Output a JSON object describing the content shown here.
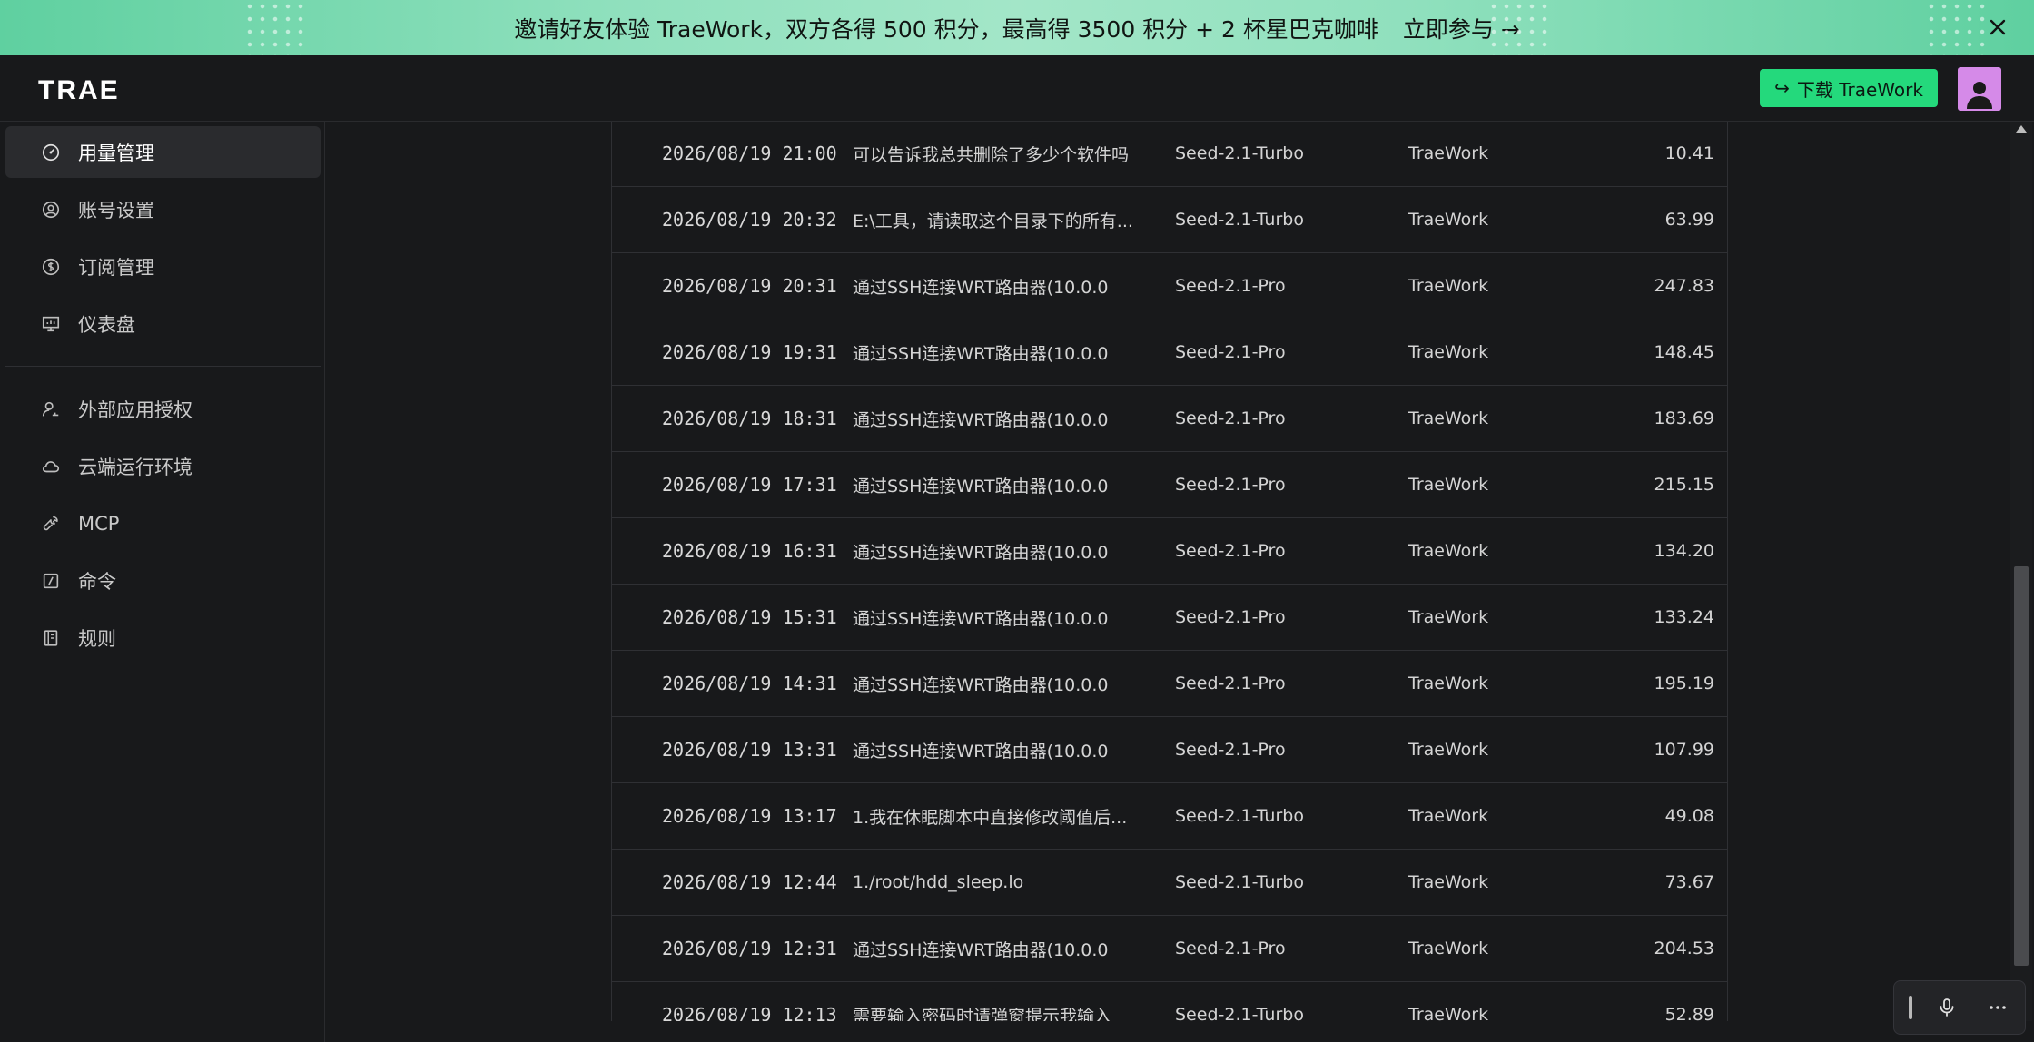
{
  "banner": {
    "text": "邀请好友体验 TraeWork，双方各得 500 积分，最高得 3500 积分 + 2 杯星巴克咖啡",
    "cta": "立即参与 →",
    "background_color": "#8fe0bd"
  },
  "header": {
    "logo": "TRAE",
    "download_label": "下载 TraeWork",
    "accent_color": "#24d97c"
  },
  "sidebar": {
    "items": [
      {
        "label": "用量管理",
        "icon": "gauge-icon",
        "active": true
      },
      {
        "label": "账号设置",
        "icon": "user-circle-icon",
        "active": false
      },
      {
        "label": "订阅管理",
        "icon": "dollar-circle-icon",
        "active": false
      },
      {
        "label": "仪表盘",
        "icon": "monitor-icon",
        "active": false
      },
      {
        "label": "外部应用授权",
        "icon": "user-key-icon",
        "active": false
      },
      {
        "label": "云端运行环境",
        "icon": "cloud-icon",
        "active": false
      },
      {
        "label": "MCP",
        "icon": "wrench-icon",
        "active": false
      },
      {
        "label": "命令",
        "icon": "slash-command-icon",
        "active": false
      },
      {
        "label": "规则",
        "icon": "rules-book-icon",
        "active": false
      }
    ]
  },
  "usage": {
    "rows": [
      {
        "time": "2026/08/19 21:00",
        "title": "可以告诉我总共删除了多少个软件吗",
        "model": "Seed-2.1-Turbo",
        "app": "TraeWork",
        "amount": "10.41"
      },
      {
        "time": "2026/08/19 20:32",
        "title": "E:\\工具，请读取这个目录下的所有...",
        "model": "Seed-2.1-Turbo",
        "app": "TraeWork",
        "amount": "63.99"
      },
      {
        "time": "2026/08/19 20:31",
        "title": "通过SSH连接WRT路由器(10.0.0",
        "model": "Seed-2.1-Pro",
        "app": "TraeWork",
        "amount": "247.83"
      },
      {
        "time": "2026/08/19 19:31",
        "title": "通过SSH连接WRT路由器(10.0.0",
        "model": "Seed-2.1-Pro",
        "app": "TraeWork",
        "amount": "148.45"
      },
      {
        "time": "2026/08/19 18:31",
        "title": "通过SSH连接WRT路由器(10.0.0",
        "model": "Seed-2.1-Pro",
        "app": "TraeWork",
        "amount": "183.69"
      },
      {
        "time": "2026/08/19 17:31",
        "title": "通过SSH连接WRT路由器(10.0.0",
        "model": "Seed-2.1-Pro",
        "app": "TraeWork",
        "amount": "215.15"
      },
      {
        "time": "2026/08/19 16:31",
        "title": "通过SSH连接WRT路由器(10.0.0",
        "model": "Seed-2.1-Pro",
        "app": "TraeWork",
        "amount": "134.20"
      },
      {
        "time": "2026/08/19 15:31",
        "title": "通过SSH连接WRT路由器(10.0.0",
        "model": "Seed-2.1-Pro",
        "app": "TraeWork",
        "amount": "133.24"
      },
      {
        "time": "2026/08/19 14:31",
        "title": "通过SSH连接WRT路由器(10.0.0",
        "model": "Seed-2.1-Pro",
        "app": "TraeWork",
        "amount": "195.19"
      },
      {
        "time": "2026/08/19 13:31",
        "title": "通过SSH连接WRT路由器(10.0.0",
        "model": "Seed-2.1-Pro",
        "app": "TraeWork",
        "amount": "107.99"
      },
      {
        "time": "2026/08/19 13:17",
        "title": "1.我在休眠脚本中直接修改阈值后...",
        "model": "Seed-2.1-Turbo",
        "app": "TraeWork",
        "amount": "49.08"
      },
      {
        "time": "2026/08/19 12:44",
        "title": "1./root/hdd_sleep.lo",
        "model": "Seed-2.1-Turbo",
        "app": "TraeWork",
        "amount": "73.67"
      },
      {
        "time": "2026/08/19 12:31",
        "title": "通过SSH连接WRT路由器(10.0.0",
        "model": "Seed-2.1-Pro",
        "app": "TraeWork",
        "amount": "204.53"
      },
      {
        "time": "2026/08/19 12:13",
        "title": "需要输入密码时请弹窗提示我输入",
        "model": "Seed-2.1-Turbo",
        "app": "TraeWork",
        "amount": "52.89"
      }
    ]
  },
  "float_toolbar": {
    "icons": [
      "drag-handle-icon",
      "microphone-icon",
      "more-icon"
    ]
  }
}
